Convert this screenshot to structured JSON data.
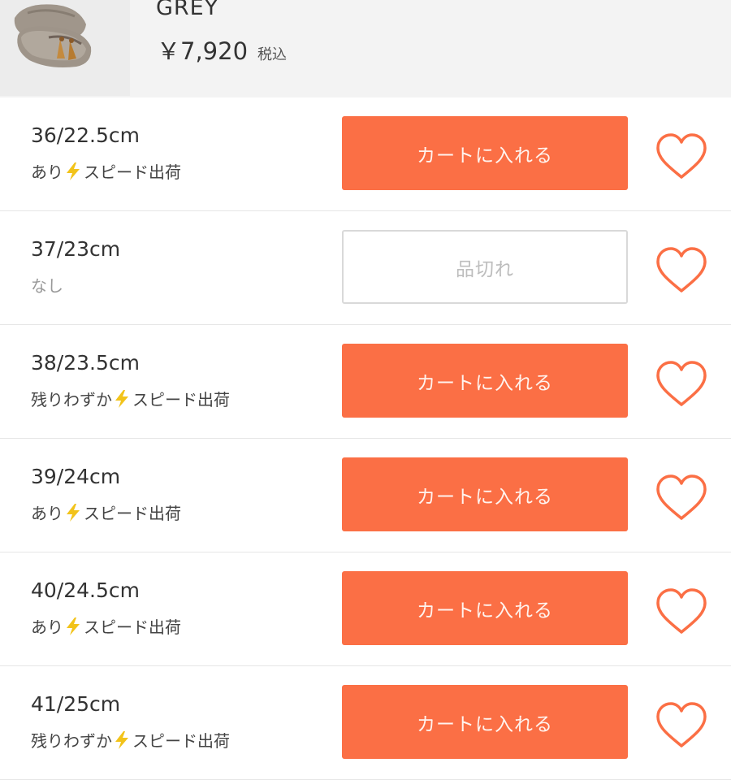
{
  "product": {
    "name": "GREY",
    "price": "￥7,920",
    "tax_label": "税込"
  },
  "colors": {
    "accent": "#fb6f45",
    "bolt": "#f2c31a"
  },
  "icons": {
    "speed": "lightning-bolt",
    "favorite": "heart-outline"
  },
  "sizes": [
    {
      "size": "36/22.5cm",
      "stock": "あり",
      "speed": "スピード出荷",
      "button": "カートに入れる"
    },
    {
      "size": "37/23cm",
      "stock": "なし",
      "speed": "",
      "button": "品切れ"
    },
    {
      "size": "38/23.5cm",
      "stock": "残りわずか",
      "speed": "スピード出荷",
      "button": "カートに入れる"
    },
    {
      "size": "39/24cm",
      "stock": "あり",
      "speed": "スピード出荷",
      "button": "カートに入れる"
    },
    {
      "size": "40/24.5cm",
      "stock": "あり",
      "speed": "スピード出荷",
      "button": "カートに入れる"
    },
    {
      "size": "41/25cm",
      "stock": "残りわずか",
      "speed": "スピード出荷",
      "button": "カートに入れる"
    }
  ]
}
